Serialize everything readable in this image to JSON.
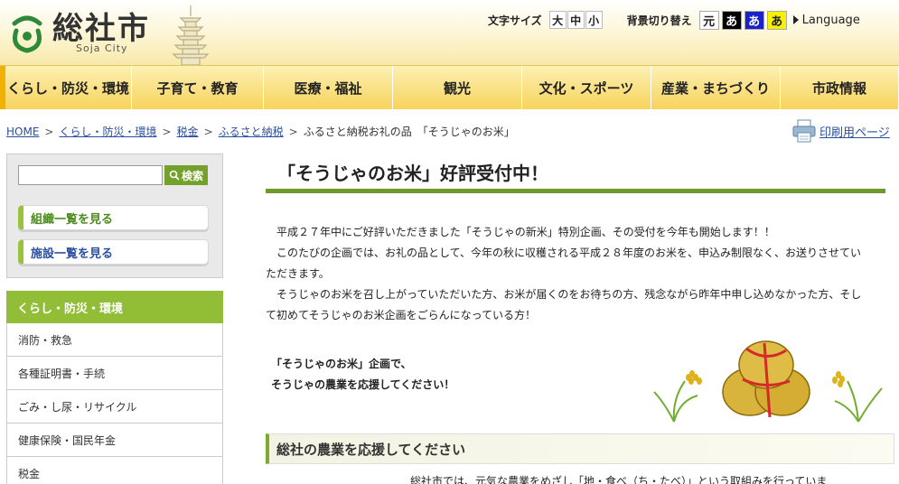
{
  "header": {
    "logo_text": "総社市",
    "logo_sub": "Soja City",
    "font_size_label": "文字サイズ",
    "font_sizes": [
      "大",
      "中",
      "小"
    ],
    "bg_label": "背景切り替え",
    "bg_options": [
      "元",
      "あ",
      "あ",
      "あ"
    ],
    "language": "Language"
  },
  "nav": {
    "items": [
      "くらし・防災・環境",
      "子育て・教育",
      "医療・福祉",
      "観光",
      "文化・スポーツ",
      "産業・まちづくり",
      "市政情報"
    ]
  },
  "breadcrumb": {
    "items": [
      "HOME",
      "くらし・防災・環境",
      "税金",
      "ふるさと納税"
    ],
    "current": "ふるさと納税お礼の品　「そうじゃのお米」",
    "separator": ">"
  },
  "print": {
    "label": "印刷用ページ"
  },
  "sidebar": {
    "search_placeholder": "",
    "search_button": "検索",
    "org_link": "組織一覧を見る",
    "facility_link": "施設一覧を見る",
    "category_title": "くらし・防災・環境",
    "categories": [
      "消防・救急",
      "各種証明書・手続",
      "ごみ・し尿・リサイクル",
      "健康保険・国民年金",
      "税金"
    ]
  },
  "main": {
    "title": "「そうじゃのお米」好評受付中！",
    "paragraphs": [
      "平成２７年中にご好評いただきました「そうじゃの新米」特別企画、その受付を今年も開始します！！",
      "このたびの企画では、お礼の品として、今年の秋に収穫される平成２８年度のお米を、申込み制限なく、お送りさせていただきます。",
      "そうじゃのお米を召し上がっていただいた方、お米が届くのをお待ちの方、残念ながら昨年中申し込めなかった方、そして初めてそうじゃのお米企画をごらんになっている方！"
    ],
    "support_lines": [
      "「そうじゃのお米」企画で、",
      "そうじゃの農業を応援してください！"
    ],
    "sub_heading": "総社の農業を応援してください",
    "lower_text": "総社市では、元気な農業をめざし「地・食べ（ち・たべ）」という取組みを行っていま"
  }
}
